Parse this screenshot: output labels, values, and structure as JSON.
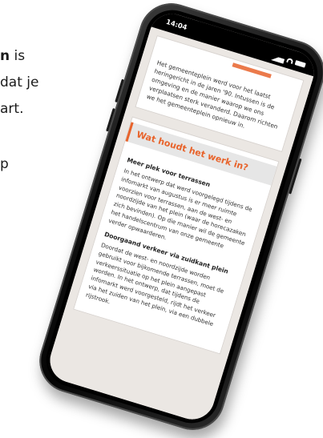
{
  "background_text": {
    "line1_bold": "n",
    "line1_rest": " is",
    "line2": "dat je",
    "line3": "art.",
    "line4": "p"
  },
  "phone": {
    "status_time": "14:04",
    "top_card_text": "Het gemeenteplein werd voor het laatst heringericht in de jaren '90. Intussen is de omgeving en de manier waarop we ons verplaatsen sterk veranderd. Daarom richten we het gemeenteplein opnieuw in.",
    "section_heading": "Wat houdt het werk in?",
    "subheading_1": "Meer plek voor terrassen",
    "paragraph_1": "In het ontwerp dat werd voorgelegd tijdens de infomarkt van augustus is er meer ruimte voorzien voor terrassen, aan de west- en noordzijde van het plein (waar de horecazaken zich bevinden). Op die manier wil de gemeente het handelscentrum van onze gemeente verder opwaarderen.",
    "subheading_2": "Doorgaand verkeer via zuidkant plein",
    "paragraph_2": "Doordat de west- en noordzijde worden gebruikt voor bijkomende terrassen, moet de verkeerssituatie op het plein aangepast worden. In het ontwerp, dat tijdens de infomarkt werd voorgesteld, rijdt het verkeer via het zuiden van het plein, via een dubbele rijstrook.",
    "accent_color": "#e8632b"
  }
}
